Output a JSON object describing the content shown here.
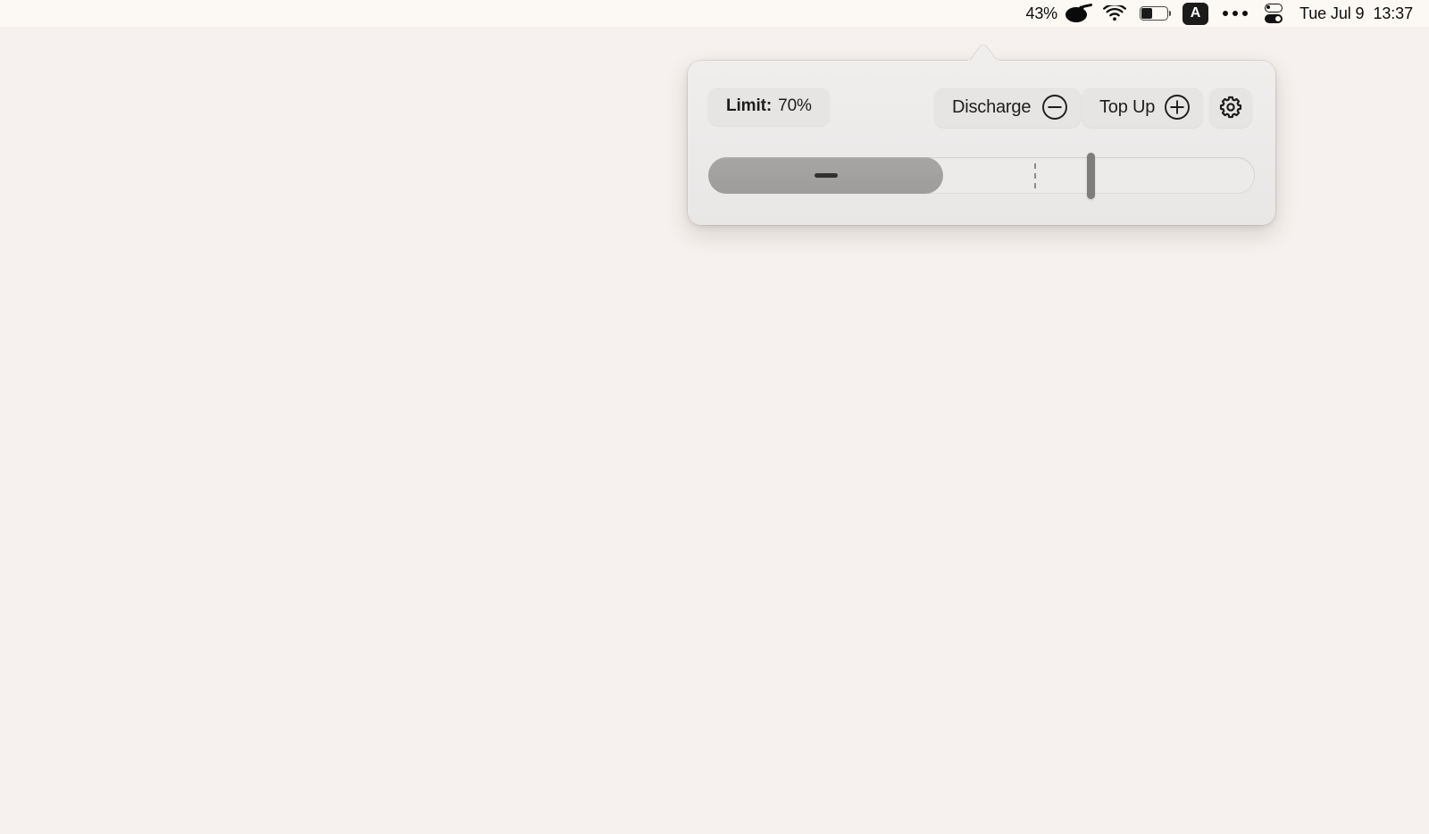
{
  "menubar": {
    "battery_percent": "43%",
    "app_icon": "bomb-icon",
    "wifi_icon": "wifi-icon",
    "battery_icon": "battery-icon",
    "battery_level": 43,
    "input_source": "A",
    "menu_extras_icon": "ellipsis-icon",
    "control_center_icon": "control-center-icon",
    "clock_date": "Tue Jul 9",
    "clock_time": "13:37",
    "background_color": "#fcf8f4"
  },
  "desktop": {
    "background_color": "#f6f1ee"
  },
  "popover": {
    "limit": {
      "label": "Limit:",
      "value": "70%"
    },
    "discharge_button": {
      "label": "Discharge",
      "icon": "minus-circle-icon"
    },
    "topup_button": {
      "label": "Top Up",
      "icon": "plus-circle-icon"
    },
    "settings_button": {
      "icon": "gear-icon"
    },
    "battery_slider": {
      "charge_percent": 43,
      "limit_percent": 70,
      "handle_percent": 70,
      "state_icon": "minus-dash-discharging",
      "fill_color": "#a1a09f",
      "track_color": "#edebea"
    }
  }
}
